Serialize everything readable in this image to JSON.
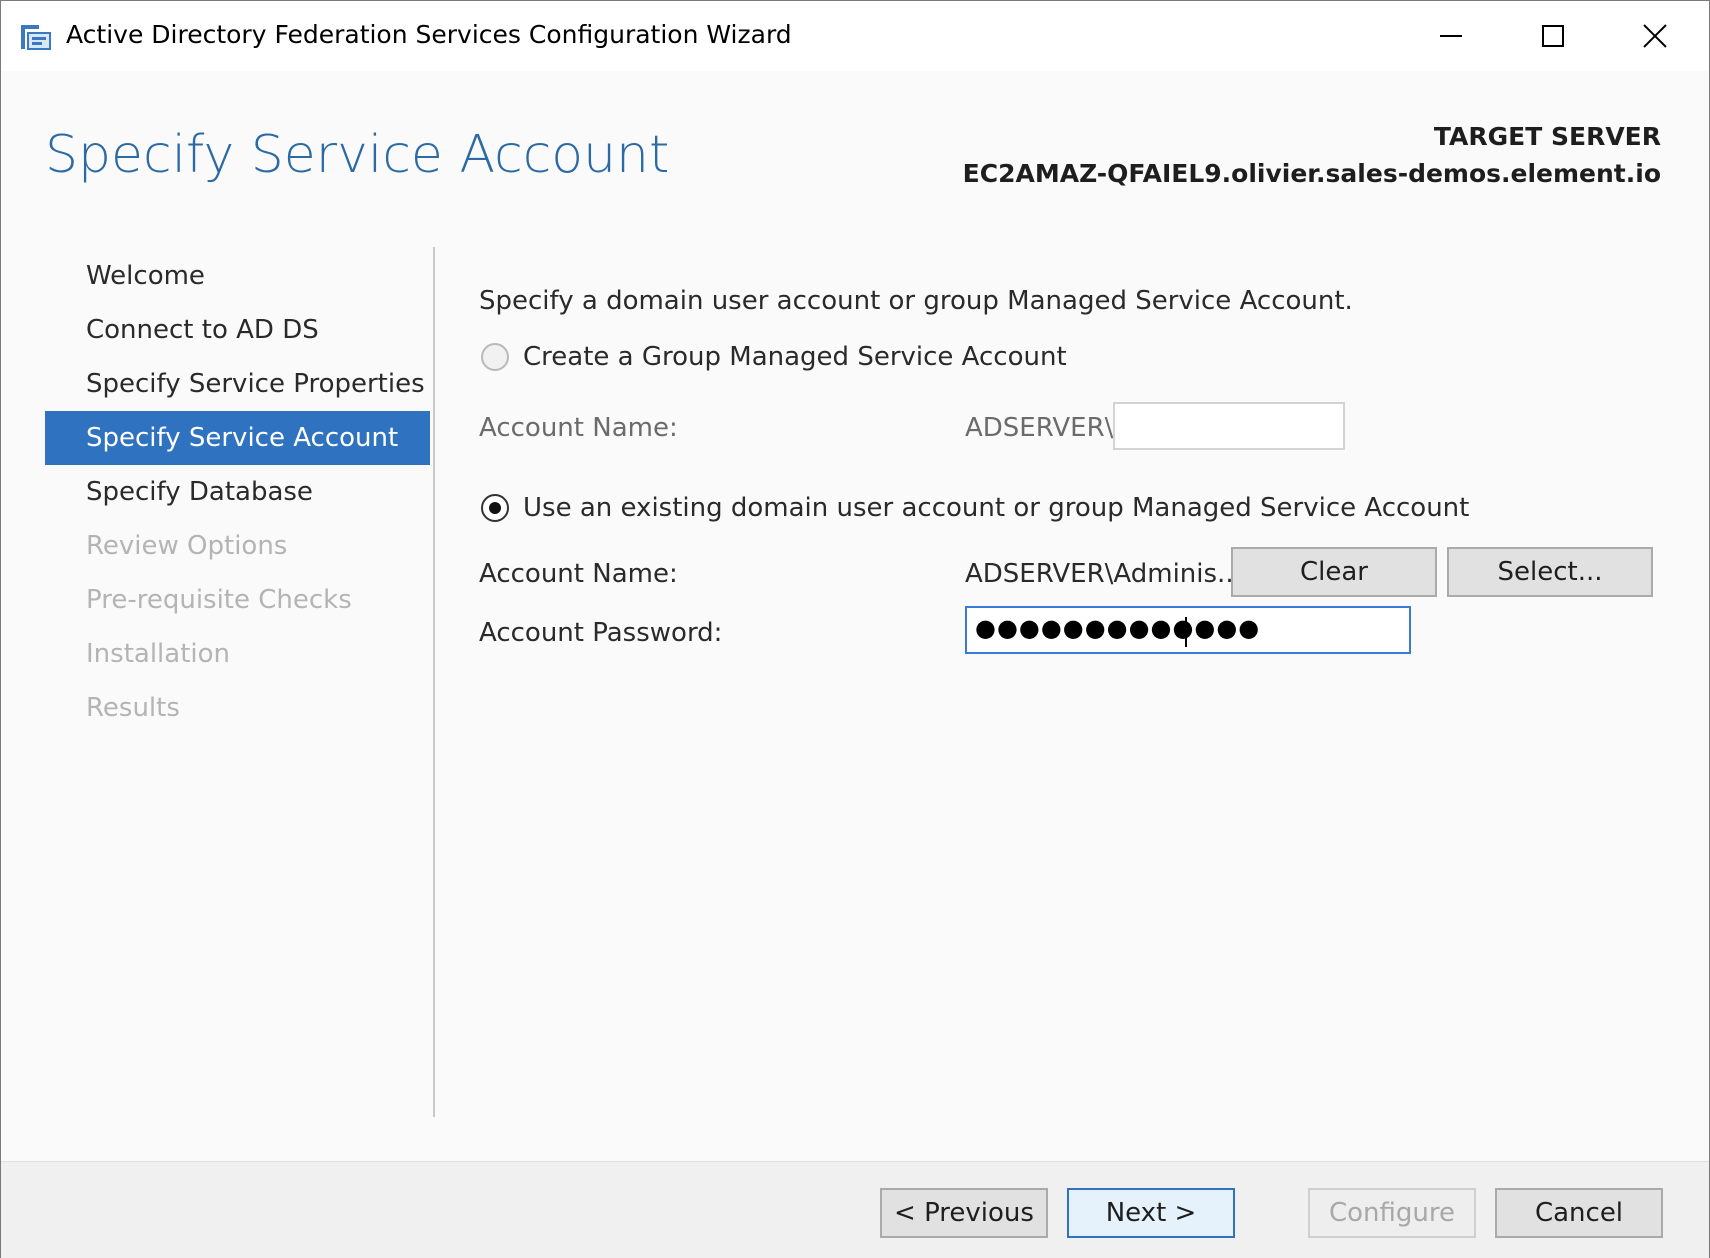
{
  "window": {
    "title": "Active Directory Federation Services Configuration Wizard",
    "app_icon": "adfs-wizard-icon",
    "controls": [
      "minimize-icon",
      "maximize-icon",
      "close-icon"
    ]
  },
  "header": {
    "page_title": "Specify Service Account",
    "target_server_label": "TARGET SERVER",
    "target_server_value": "EC2AMAZ-QFAIEL9.olivier.sales-demos.element.io"
  },
  "nav": {
    "items": [
      {
        "label": "Welcome",
        "state": "normal"
      },
      {
        "label": "Connect to AD DS",
        "state": "normal"
      },
      {
        "label": "Specify Service Properties",
        "state": "normal"
      },
      {
        "label": "Specify Service Account",
        "state": "active"
      },
      {
        "label": "Specify Database",
        "state": "normal"
      },
      {
        "label": "Review Options",
        "state": "disabled"
      },
      {
        "label": "Pre-requisite Checks",
        "state": "disabled"
      },
      {
        "label": "Installation",
        "state": "disabled"
      },
      {
        "label": "Results",
        "state": "disabled"
      }
    ]
  },
  "main": {
    "intro": "Specify a domain user account or group Managed Service Account.",
    "option_create": {
      "label": "Create a Group Managed Service Account",
      "selected": false,
      "account_name_label": "Account Name:",
      "domain_prefix": "ADSERVER\\",
      "account_name_value": ""
    },
    "option_existing": {
      "label": "Use an existing domain user account or group Managed Service Account",
      "selected": true,
      "account_name_label": "Account Name:",
      "account_name_value": "ADSERVER\\Adminis...",
      "clear_label": "Clear",
      "select_label": "Select...",
      "password_label": "Account Password:",
      "password_value": "●●●●●●●●●●●●●"
    }
  },
  "footer": {
    "previous_label": "< Previous",
    "next_label": "Next >",
    "configure_label": "Configure",
    "cancel_label": "Cancel"
  },
  "colors": {
    "accent": "#2f73c0",
    "title_blue": "#2c6aa4",
    "disabled_text": "#b4b4b4"
  }
}
